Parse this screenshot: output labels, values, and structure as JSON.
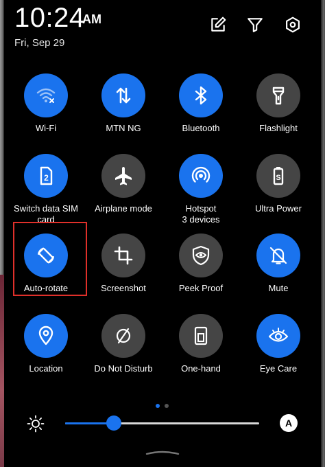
{
  "status": {
    "time": "10:24",
    "ampm": "AM",
    "date": "Fri, Sep 29",
    "icons": [
      "edit-icon",
      "filter-icon",
      "settings-icon"
    ]
  },
  "tiles": [
    {
      "id": "wifi",
      "label": "Wi-Fi",
      "label2": "",
      "state": "on",
      "icon": "wifi-icon"
    },
    {
      "id": "mtn",
      "label": "MTN NG",
      "label2": "",
      "state": "on",
      "icon": "mobile-data-icon"
    },
    {
      "id": "bluetooth",
      "label": "Bluetooth",
      "label2": "",
      "state": "on",
      "icon": "bluetooth-icon"
    },
    {
      "id": "flashlight",
      "label": "Flashlight",
      "label2": "",
      "state": "off",
      "icon": "flashlight-icon"
    },
    {
      "id": "switch-sim",
      "label": "Switch data SIM",
      "label2": "card",
      "state": "on",
      "icon": "sim-card-icon"
    },
    {
      "id": "airplane",
      "label": "Airplane mode",
      "label2": "",
      "state": "off",
      "icon": "airplane-icon"
    },
    {
      "id": "hotspot",
      "label": "Hotspot",
      "label2": "3 devices",
      "state": "on",
      "icon": "hotspot-icon"
    },
    {
      "id": "ultra-power",
      "label": "Ultra Power",
      "label2": "",
      "state": "off",
      "icon": "battery-saver-icon"
    },
    {
      "id": "auto-rotate",
      "label": "Auto-rotate",
      "label2": "",
      "state": "on",
      "icon": "rotate-icon"
    },
    {
      "id": "screenshot",
      "label": "Screenshot",
      "label2": "",
      "state": "off",
      "icon": "crop-icon"
    },
    {
      "id": "peek-proof",
      "label": "Peek Proof",
      "label2": "",
      "state": "off",
      "icon": "eye-shield-icon"
    },
    {
      "id": "mute",
      "label": "Mute",
      "label2": "",
      "state": "on",
      "icon": "bell-off-icon"
    },
    {
      "id": "location",
      "label": "Location",
      "label2": "",
      "state": "on",
      "icon": "location-pin-icon"
    },
    {
      "id": "dnd",
      "label": "Do Not Disturb",
      "label2": "",
      "state": "off",
      "icon": "do-not-disturb-icon"
    },
    {
      "id": "one-hand",
      "label": "One-hand",
      "label2": "",
      "state": "off",
      "icon": "one-hand-icon"
    },
    {
      "id": "eye-care",
      "label": "Eye Care",
      "label2": "",
      "state": "on",
      "icon": "eye-icon"
    }
  ],
  "pager": {
    "pages": 2,
    "current": 0
  },
  "brightness": {
    "level": 0.25,
    "auto_label": "A"
  },
  "colors": {
    "accent": "#1a73ee",
    "tile_off": "#454545",
    "highlight": "#e0302a",
    "background": "#000000"
  }
}
